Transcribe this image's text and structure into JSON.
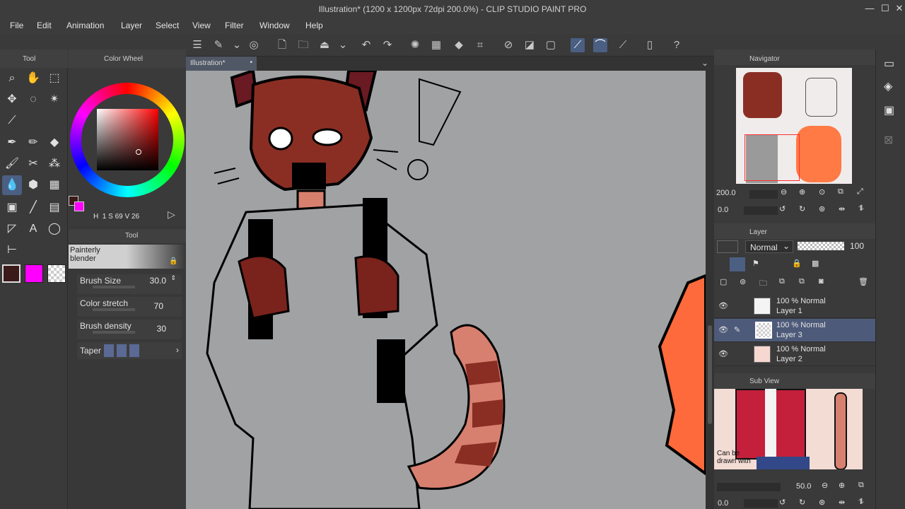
{
  "window": {
    "title": "Illustration* (1200 x 1200px 72dpi 200.0%) - CLIP STUDIO PAINT PRO",
    "controls": [
      "—",
      "☐",
      "✕"
    ]
  },
  "menu": [
    "File",
    "Edit",
    "Animation",
    "Layer",
    "Select",
    "View",
    "Filter",
    "Window",
    "Help"
  ],
  "document_tab": {
    "label": "Illustration*",
    "close": "•"
  },
  "tool_panel": {
    "title": "Tool"
  },
  "color_panel": {
    "title": "Color Wheel",
    "readout": {
      "h": "H",
      "hv": "1",
      "s": "S",
      "sv": "69",
      "v": "V",
      "vv": "26"
    },
    "main_color": "#3b1a1a",
    "sub_color": "#ff00ff"
  },
  "subtool_panel": {
    "tab_label": "Tool",
    "selected": "Painterly blender",
    "properties": [
      {
        "label": "Brush Size",
        "value": "30.0"
      },
      {
        "label": "Color stretch",
        "value": "70"
      },
      {
        "label": "Brush density",
        "value": "30"
      },
      {
        "label": "Taper",
        "value": ""
      }
    ]
  },
  "navigator": {
    "title": "Navigator",
    "zoom": "200.0",
    "rotation": "0.0"
  },
  "layer_panel": {
    "title": "Layer",
    "blend_mode": "Normal",
    "opacity": "100",
    "layers": [
      {
        "mode": "100 % Normal",
        "name": "Layer 1",
        "selected": false
      },
      {
        "mode": "100 % Normal",
        "name": "Layer 3",
        "selected": true
      },
      {
        "mode": "100 % Normal",
        "name": "Layer 2",
        "selected": false
      }
    ]
  },
  "sub_view": {
    "title": "Sub View",
    "caption": "Can be drawn with",
    "zoom": "50.0",
    "rotation": "0.0"
  },
  "colors": {
    "accent": "#4a5f82",
    "canvas_bg": "#a0a2a4",
    "fur_red": "#8a2e24",
    "tail_orange": "#d88070",
    "orange_char": "#ff6a3c"
  }
}
